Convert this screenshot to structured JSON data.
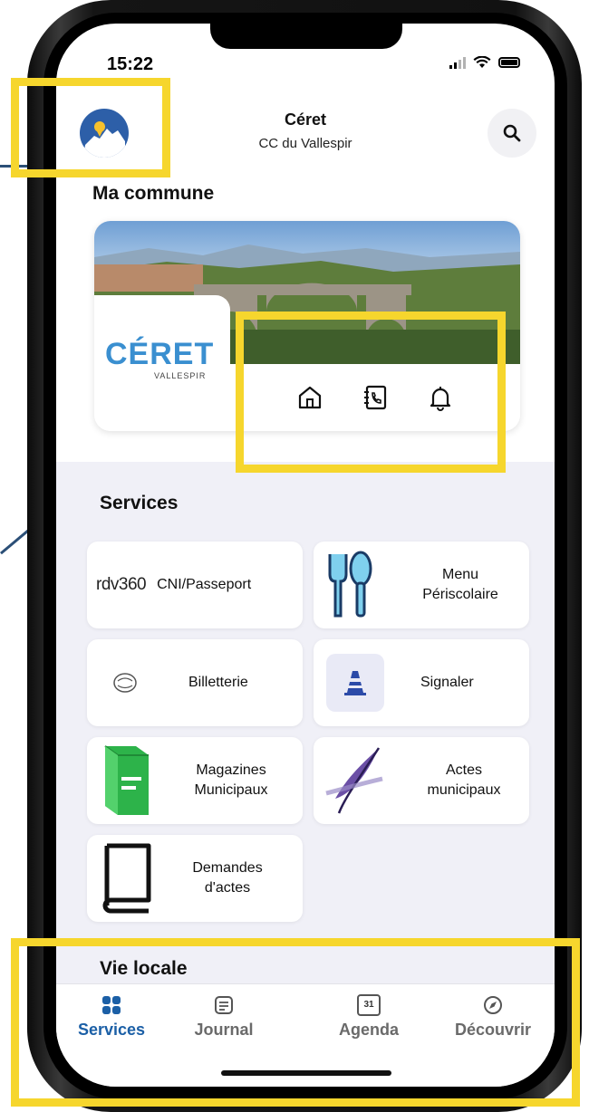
{
  "status_bar": {
    "time": "15:22"
  },
  "header": {
    "title": "Céret",
    "subtitle": "CC du Vallespir"
  },
  "commune": {
    "section_title": "Ma commune",
    "logo_text": "CÉRET",
    "logo_sub": "VALLESPIR",
    "quick_icons": [
      "home-icon",
      "contacts-icon",
      "bell-icon"
    ]
  },
  "services": {
    "section_title": "Services",
    "tiles": [
      {
        "brand": "rdv360",
        "label": "CNI/Passeport",
        "icon": "rdv360-logo"
      },
      {
        "label": "Menu Périscolaire",
        "icon": "cutlery-icon"
      },
      {
        "label": "Billetterie",
        "icon": "billetterie-logo"
      },
      {
        "label": "Signaler",
        "icon": "cone-icon"
      },
      {
        "label": "Magazines Municipaux",
        "icon": "magazine-icon"
      },
      {
        "label": "Actes municipaux",
        "icon": "quill-icon"
      },
      {
        "label": "Demandes d'actes",
        "icon": "book-icon"
      }
    ]
  },
  "vie_locale": {
    "section_title": "Vie locale"
  },
  "bottom_nav": {
    "items": [
      {
        "label": "Services",
        "icon": "grid-icon",
        "active": true
      },
      {
        "label": "Journal",
        "icon": "journal-icon"
      },
      {
        "label": "Agenda",
        "icon": "calendar-icon",
        "badge": "31"
      },
      {
        "label": "Découvrir",
        "icon": "compass-icon"
      }
    ]
  },
  "colors": {
    "accent": "#1b5fa6",
    "highlight": "#f6d62d",
    "services_bg": "#f0f0f7"
  }
}
